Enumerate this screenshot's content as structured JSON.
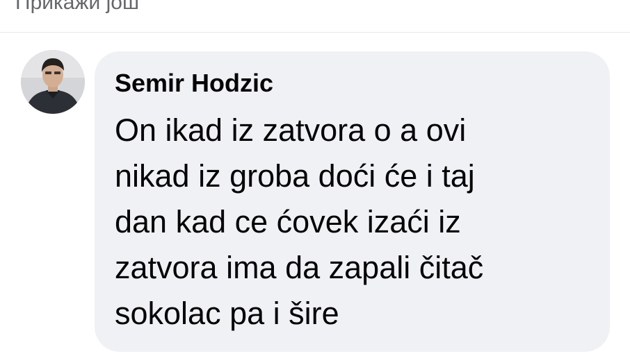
{
  "show_more": {
    "label": "Прикажи још"
  },
  "comment": {
    "author": "Semir Hodzic",
    "lines": [
      "On ikad iz zatvora o a ovi",
      "nikad iz groba doći će i taj",
      "dan kad ce ćovek izaći iz",
      "zatvora ima da zapali čitač",
      "sokolac pa i šire"
    ]
  },
  "colors": {
    "bubble_background": "#f0f1f5",
    "text": "#050505",
    "secondary_text": "#65676b"
  }
}
